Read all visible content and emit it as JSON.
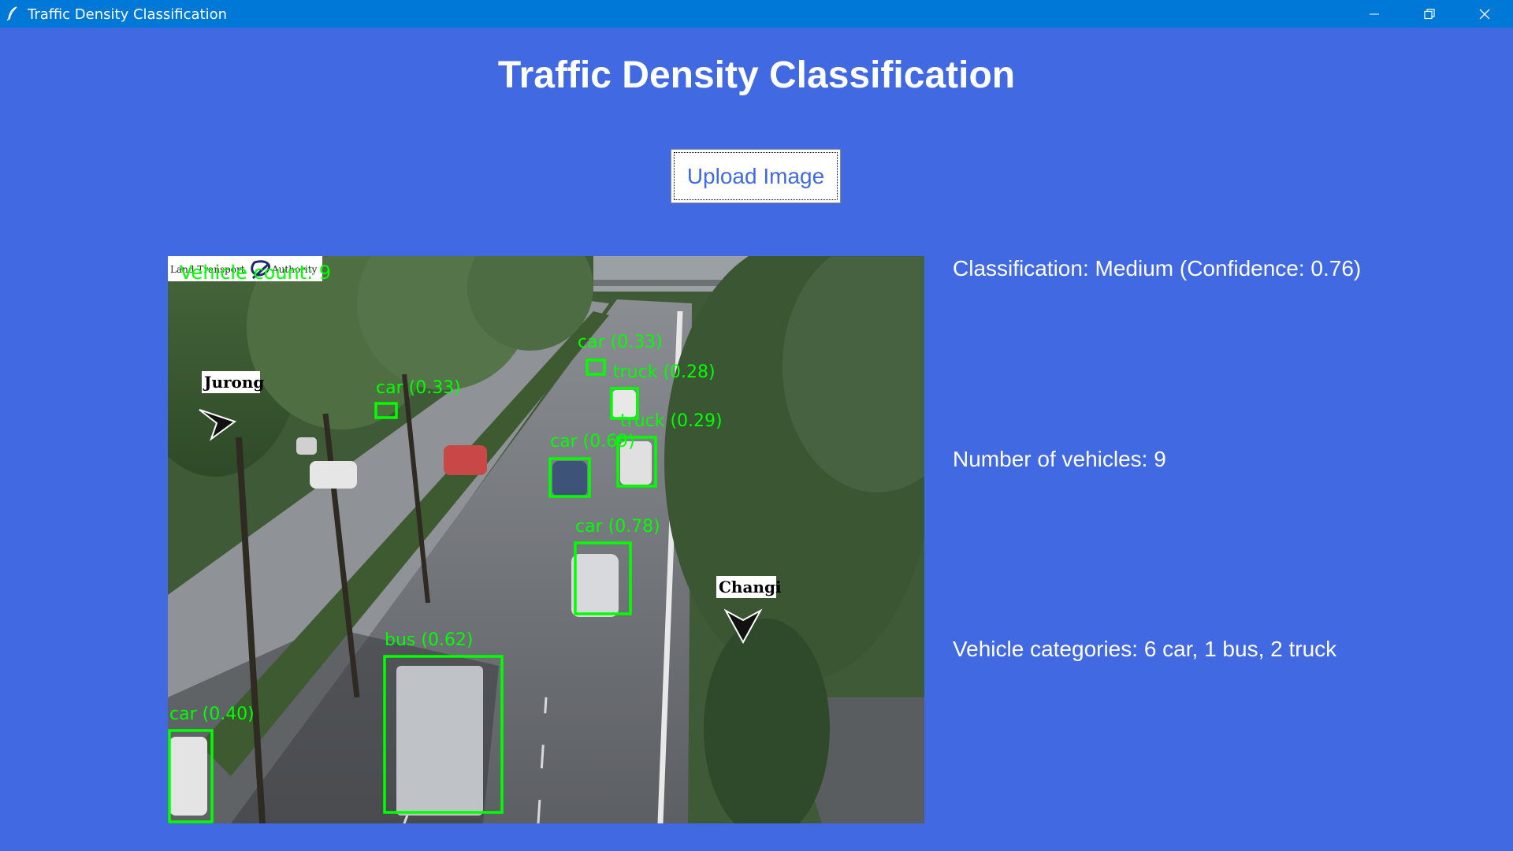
{
  "window": {
    "title": "Traffic Density Classification",
    "app_icon": "feather-icon",
    "controls": [
      "minimize-icon",
      "restore-icon",
      "close-icon"
    ]
  },
  "header": {
    "title": "Traffic Density Classification"
  },
  "upload": {
    "label": "Upload Image"
  },
  "results": {
    "classification": "Classification: Medium (Confidence: 0.76)",
    "vehicle_count": "Number of vehicles: 9",
    "categories": "Vehicle categories: 6 car, 1 bus, 2 truck"
  },
  "camera_image": {
    "watermark_left": "Land Transport",
    "watermark_right": "Authority",
    "overlay_count": "Vehicle count: 9",
    "sign_left": "Jurong",
    "sign_right": "Changi",
    "detections": [
      {
        "label": "car (0.33)"
      },
      {
        "label": "truck (0.28)"
      },
      {
        "label": "car (0.33)"
      },
      {
        "label": "truck (0.29)"
      },
      {
        "label": "car (0.69)"
      },
      {
        "label": "car (0.78)"
      },
      {
        "label": "bus (0.62)"
      },
      {
        "label": "car (0.40)"
      }
    ]
  },
  "colors": {
    "background": "#4169e1",
    "titlebar": "#0078d7",
    "detection_box": "#00ff00",
    "button_text": "#4169e1"
  }
}
